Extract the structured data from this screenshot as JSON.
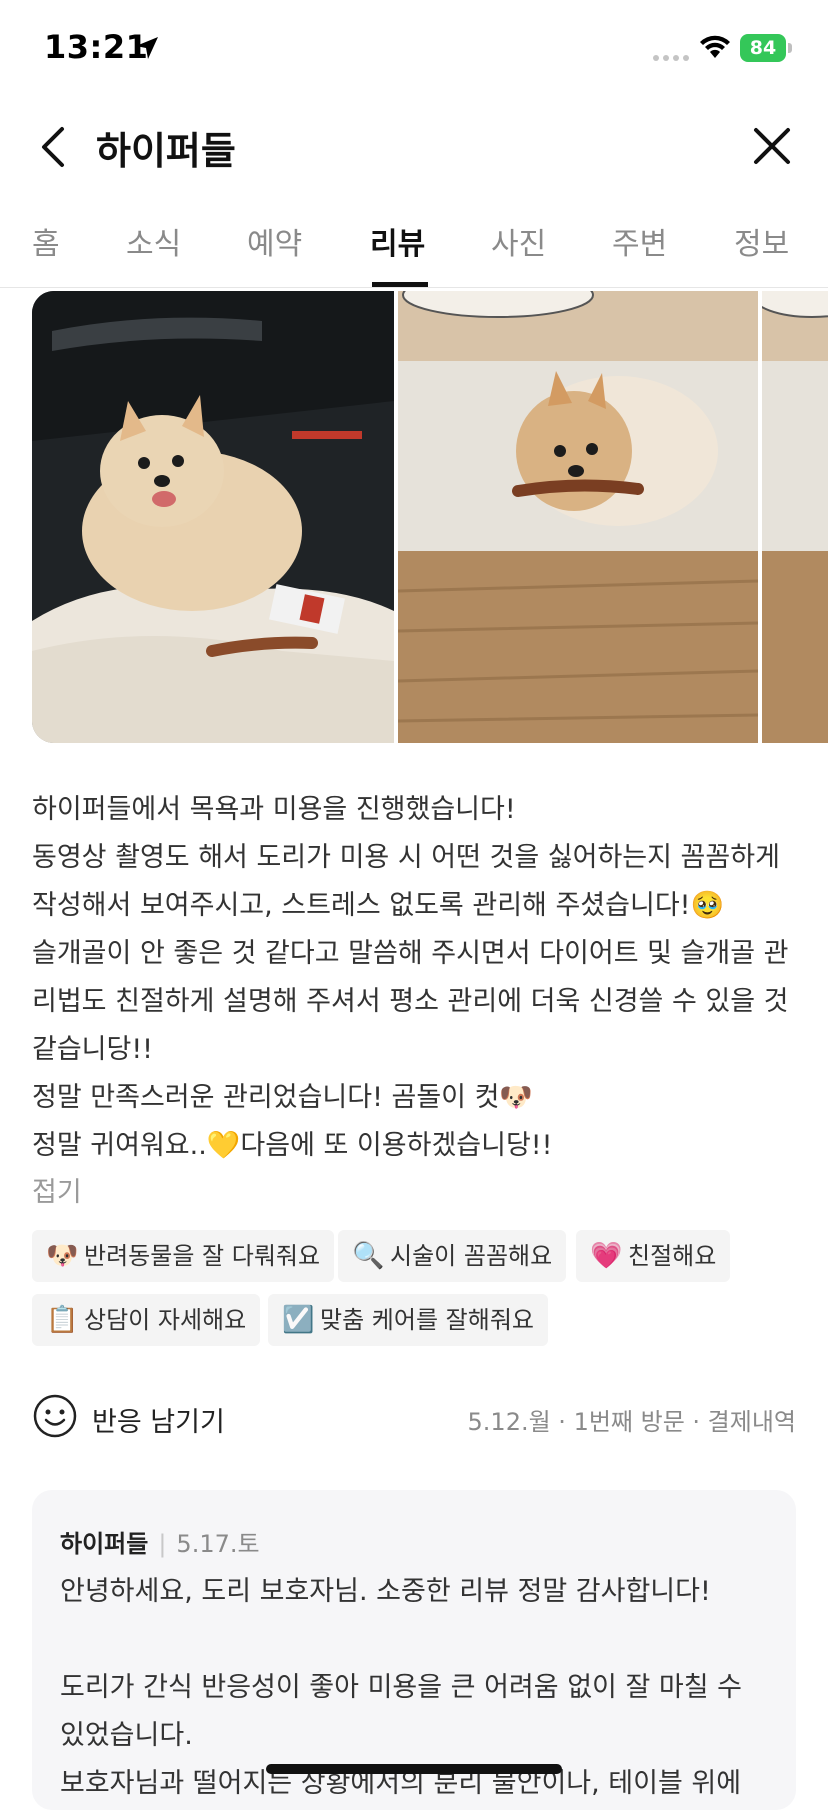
{
  "status": {
    "time": "13:21",
    "battery": "84"
  },
  "nav": {
    "title": "하이퍼들"
  },
  "tabs": [
    "홈",
    "소식",
    "예약",
    "리뷰",
    "사진",
    "주변",
    "정보"
  ],
  "active_tab": "리뷰",
  "review": {
    "lines": [
      "하이퍼들에서 목욕과 미용을 진행했습니다!",
      "동영상 촬영도 해서 도리가 미용 시 어떤 것을 싫어하는지 꼼꼼하게",
      "작성해서 보여주시고, 스트레스 없도록 관리해 주셨습니다!🥹",
      "슬개골이 안 좋은 것 같다고 말씀해 주시면서 다이어트 및 슬개골 관",
      "리법도 친절하게 설명해 주셔서 평소 관리에 더욱 신경쓸 수 있을 것",
      "같습니당!!",
      "정말 만족스러운 관리었습니다! 곰돌이 컷🐶",
      "정말 귀여워요..💛다음에 또 이용하겠습니당!!"
    ],
    "fold_label": "접기"
  },
  "tags": [
    {
      "emoji": "🐶",
      "label": "반려동물을 잘 다뤄줘요"
    },
    {
      "emoji": "🔍",
      "label": "시술이 꼼꼼해요"
    },
    {
      "emoji": "💗",
      "label": "친절해요"
    },
    {
      "emoji": "📋",
      "label": "상담이 자세해요"
    },
    {
      "emoji": "☑️",
      "label": "맞춤 케어를 잘해줘요"
    }
  ],
  "reaction": {
    "label": "반응 남기기",
    "meta": "5.12.월 · 1번째 방문 · 결제내역"
  },
  "owner_reply": {
    "name": "하이퍼들",
    "date": "5.17.토",
    "lines": [
      "안녕하세요, 도리 보호자님. 소중한 리뷰 정말 감사합니다!",
      "",
      "도리가 간식 반응성이 좋아 미용을 큰 어려움 없이 잘 마칠 수",
      "있었습니다.",
      "보호자님과 떨어지는 상황에서의 분리 불안이나, 테이블 위에"
    ]
  }
}
